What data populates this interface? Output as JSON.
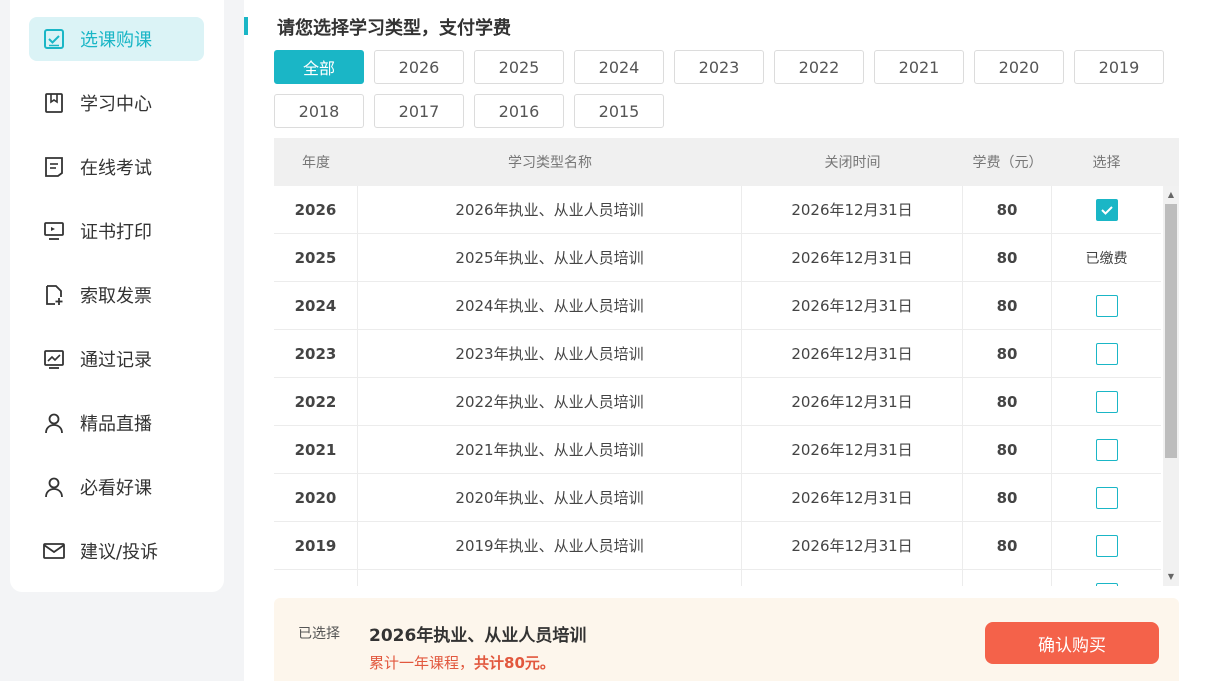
{
  "sidebar": {
    "items": [
      {
        "label": "选课购课",
        "icon": "checkbox-icon",
        "active": true
      },
      {
        "label": "学习中心",
        "icon": "bookmark-icon"
      },
      {
        "label": "在线考试",
        "icon": "document-icon"
      },
      {
        "label": "证书打印",
        "icon": "monitor-icon"
      },
      {
        "label": "索取发票",
        "icon": "file-add-icon"
      },
      {
        "label": "通过记录",
        "icon": "chart-icon"
      },
      {
        "label": "精品直播",
        "icon": "user-icon"
      },
      {
        "label": "必看好课",
        "icon": "user-icon"
      },
      {
        "label": "建议/投诉",
        "icon": "mail-icon"
      }
    ]
  },
  "main": {
    "title": "请您选择学习类型，支付学费",
    "year_filters": [
      "全部",
      "2026",
      "2025",
      "2024",
      "2023",
      "2022",
      "2021",
      "2020",
      "2019",
      "2018",
      "2017",
      "2016",
      "2015"
    ],
    "active_filter": "全部"
  },
  "table": {
    "headers": [
      "年度",
      "学习类型名称",
      "关闭时间",
      "学费（元）",
      "选择"
    ],
    "rows": [
      {
        "year": "2026",
        "name": "2026年执业、从业人员培训",
        "close": "2026年12月31日",
        "fee": "80",
        "status": "checked"
      },
      {
        "year": "2025",
        "name": "2025年执业、从业人员培训",
        "close": "2026年12月31日",
        "fee": "80",
        "status": "已缴费"
      },
      {
        "year": "2024",
        "name": "2024年执业、从业人员培训",
        "close": "2026年12月31日",
        "fee": "80",
        "status": "unchecked"
      },
      {
        "year": "2023",
        "name": "2023年执业、从业人员培训",
        "close": "2026年12月31日",
        "fee": "80",
        "status": "unchecked"
      },
      {
        "year": "2022",
        "name": "2022年执业、从业人员培训",
        "close": "2026年12月31日",
        "fee": "80",
        "status": "unchecked"
      },
      {
        "year": "2021",
        "name": "2021年执业、从业人员培训",
        "close": "2026年12月31日",
        "fee": "80",
        "status": "unchecked"
      },
      {
        "year": "2020",
        "name": "2020年执业、从业人员培训",
        "close": "2026年12月31日",
        "fee": "80",
        "status": "unchecked"
      },
      {
        "year": "2019",
        "name": "2019年执业、从业人员培训",
        "close": "2026年12月31日",
        "fee": "80",
        "status": "unchecked"
      },
      {
        "year": "",
        "name": "",
        "close": "",
        "fee": "",
        "status": "unchecked"
      }
    ]
  },
  "footer": {
    "label": "已选择",
    "selected_name": "2026年执业、从业人员培训",
    "summary_prefix": "累计一年课程，",
    "summary_total": "共计80元。",
    "buy_label": "确认购买"
  },
  "colors": {
    "accent": "#1ab6c6",
    "price": "#e2583e",
    "buy": "#f4624a"
  }
}
